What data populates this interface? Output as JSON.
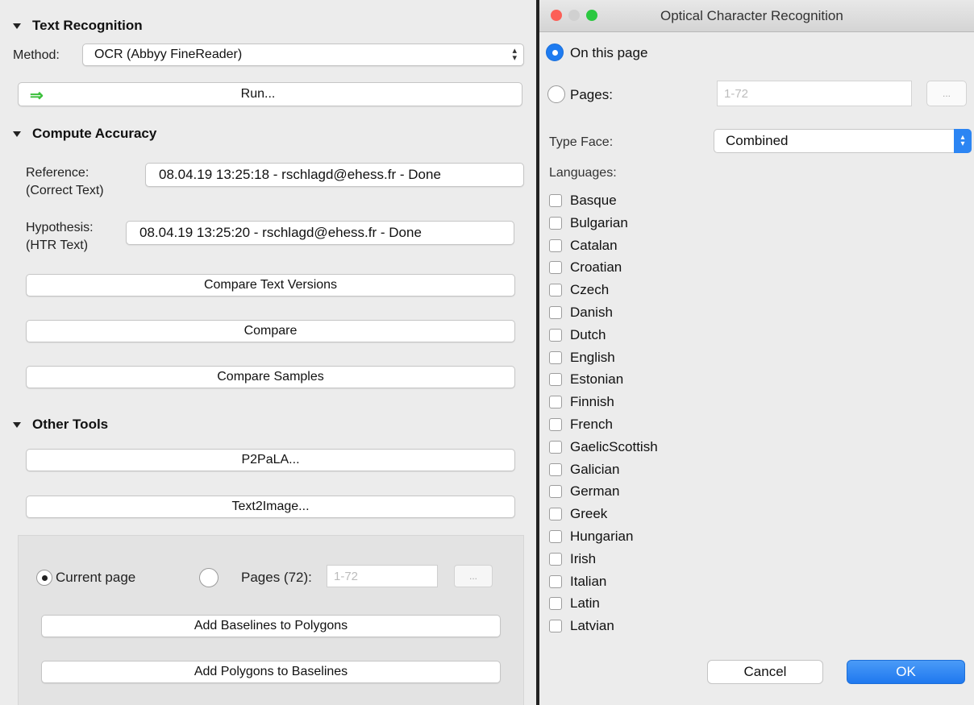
{
  "left": {
    "text_recognition": {
      "header": "Text Recognition",
      "method_label": "Method:",
      "method_value": "OCR (Abbyy FineReader)",
      "run_label": "Run..."
    },
    "compute_accuracy": {
      "header": "Compute Accuracy",
      "reference_label_1": "Reference:",
      "reference_label_2": "(Correct Text)",
      "reference_value": "08.04.19 13:25:18 - rschlagd@ehess.fr - Done",
      "hypothesis_label_1": "Hypothesis:",
      "hypothesis_label_2": "(HTR Text)",
      "hypothesis_value": "08.04.19 13:25:20 - rschlagd@ehess.fr - Done",
      "compare_text_versions": "Compare Text Versions",
      "compare": "Compare",
      "compare_samples": "Compare Samples"
    },
    "other_tools": {
      "header": "Other Tools",
      "p2pala": "P2PaLA...",
      "text2image": "Text2Image...",
      "current_page": "Current page",
      "pages_label": "Pages (72):",
      "pages_placeholder": "1-72",
      "ellipsis": "...",
      "add_baselines": "Add Baselines to Polygons",
      "add_polygons": "Add Polygons to Baselines"
    }
  },
  "dialog": {
    "title": "Optical Character Recognition",
    "on_this_page": "On this page",
    "pages_label": "Pages:",
    "pages_placeholder": "1-72",
    "ellipsis": "...",
    "type_face_label": "Type Face:",
    "type_face_value": "Combined",
    "languages_label": "Languages:",
    "languages": [
      "Basque",
      "Bulgarian",
      "Catalan",
      "Croatian",
      "Czech",
      "Danish",
      "Dutch",
      "English",
      "Estonian",
      "Finnish",
      "French",
      "GaelicScottish",
      "Galician",
      "German",
      "Greek",
      "Hungarian",
      "Irish",
      "Italian",
      "Latin",
      "Latvian"
    ],
    "cancel": "Cancel",
    "ok": "OK",
    "colors": {
      "accent": "#1e7bf0",
      "close": "#fc5f57",
      "minimize": "#fdbd2e",
      "zoom": "#2bc840",
      "arrow": "#3cbf3c"
    }
  }
}
